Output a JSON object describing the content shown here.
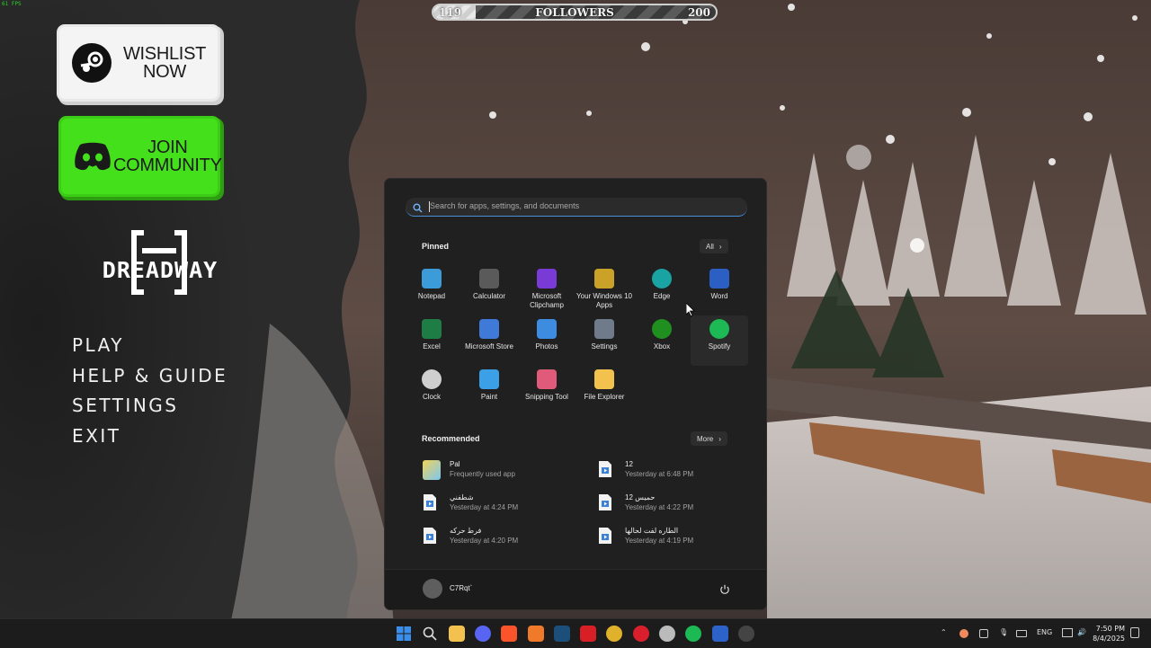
{
  "hud": {
    "fps": "61 FPS"
  },
  "followers": {
    "min": "119",
    "label": "FOLLOWERS",
    "max": "200",
    "progress": 0.15
  },
  "promo": {
    "wishlist": {
      "line1": "WISHLIST",
      "line2": "NOW",
      "icon": "steam-icon"
    },
    "community": {
      "line1": "JOIN",
      "line2": "COMMUNITY",
      "icon": "discord-icon"
    }
  },
  "game": {
    "logo_text": "DREADWAY",
    "menu": [
      "PLAY",
      "HELP & GUIDE",
      "SETTINGS",
      "EXIT"
    ]
  },
  "start_menu": {
    "search_placeholder": "Search for apps, settings, and documents",
    "pinned_title": "Pinned",
    "all_label": "All",
    "pinned": [
      {
        "label": "Notepad",
        "icon": "notepad-icon",
        "color": "#3c9bd9"
      },
      {
        "label": "Calculator",
        "icon": "calculator-icon",
        "color": "#5a5a5a"
      },
      {
        "label": "Microsoft Clipchamp",
        "icon": "clipchamp-icon",
        "color": "#7a3ad6"
      },
      {
        "label": "Your Windows 10 Apps",
        "icon": "windows-apps-icon",
        "color": "#c9a227"
      },
      {
        "label": "Edge",
        "icon": "edge-icon",
        "color": "#1aa3a3"
      },
      {
        "label": "Word",
        "icon": "word-icon",
        "color": "#2b5fc4"
      },
      {
        "label": "Excel",
        "icon": "excel-icon",
        "color": "#1e7d45"
      },
      {
        "label": "Microsoft Store",
        "icon": "store-icon",
        "color": "#3f7ad8"
      },
      {
        "label": "Photos",
        "icon": "photos-icon",
        "color": "#3d8ce0"
      },
      {
        "label": "Settings",
        "icon": "settings-icon",
        "color": "#6f7b8a"
      },
      {
        "label": "Xbox",
        "icon": "xbox-icon",
        "color": "#1f8f1f"
      },
      {
        "label": "Spotify",
        "icon": "spotify-icon",
        "color": "#1db954"
      },
      {
        "label": "Clock",
        "icon": "clock-icon",
        "color": "#cfcfcf"
      },
      {
        "label": "Paint",
        "icon": "paint-icon",
        "color": "#3ba0e6"
      },
      {
        "label": "Snipping Tool",
        "icon": "snipping-tool-icon",
        "color": "#e05a7a"
      },
      {
        "label": "File Explorer",
        "icon": "file-explorer-icon",
        "color": "#f2c14e"
      }
    ],
    "recommended_title": "Recommended",
    "more_label": "More",
    "recommended": [
      {
        "name": "Pal",
        "time": "Frequently used app",
        "icon": "pal-app-icon"
      },
      {
        "name": "12",
        "time": "Yesterday at 6:48 PM",
        "icon": "video-file-icon"
      },
      {
        "name": "شطفني",
        "time": "Yesterday at 4:24 PM",
        "icon": "video-file-icon"
      },
      {
        "name": "حميس 12",
        "time": "Yesterday at 4:22 PM",
        "icon": "video-file-icon"
      },
      {
        "name": "فرط حركه",
        "time": "Yesterday at 4:20 PM",
        "icon": "video-file-icon"
      },
      {
        "name": "الطاره لفت لحالها",
        "time": "Yesterday at 4:19 PM",
        "icon": "video-file-icon"
      }
    ],
    "user_name": "C7Rqt`"
  },
  "taskbar": {
    "apps": [
      {
        "icon": "windows-start-icon",
        "color": "#3b8eea"
      },
      {
        "icon": "search-icon",
        "color": "#dddddd"
      },
      {
        "icon": "file-explorer-icon",
        "color": "#f2c14e"
      },
      {
        "icon": "discord-icon",
        "color": "#5865f2"
      },
      {
        "icon": "brave-icon",
        "color": "#fb542b"
      },
      {
        "icon": "app-a-icon",
        "color": "#f07a2a"
      },
      {
        "icon": "steam-icon",
        "color": "#1b4f7a"
      },
      {
        "icon": "netflix-icon",
        "color": "#d81f26"
      },
      {
        "icon": "chrome-icon",
        "color": "#e0b12a"
      },
      {
        "icon": "opera-icon",
        "color": "#d91f2c"
      },
      {
        "icon": "xbox-game-bar-icon",
        "color": "#bbbbbb"
      },
      {
        "icon": "spotify-icon",
        "color": "#1db954"
      },
      {
        "icon": "tablet-app-icon",
        "color": "#2d63c8"
      },
      {
        "icon": "game-icon",
        "color": "#444444"
      }
    ],
    "lang": "ENG",
    "time": "7:50 PM",
    "date": "8/4/2025"
  }
}
